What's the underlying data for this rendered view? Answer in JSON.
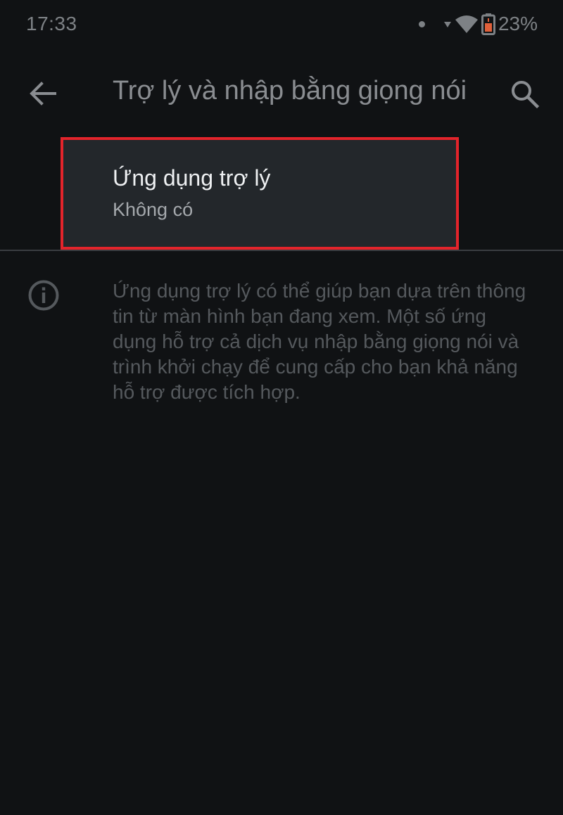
{
  "status_bar": {
    "time": "17:33",
    "battery_percent": "23%",
    "icons": [
      "notification-dot-icon",
      "data-arrow-icon",
      "wifi-icon",
      "battery-icon"
    ]
  },
  "app_bar": {
    "title": "Trợ lý và nhập bằng giọng nói",
    "icons": [
      "back-arrow-icon",
      "search-icon"
    ]
  },
  "settings": {
    "assistant_app": {
      "title": "Ứng dụng trợ lý",
      "value": "Không có"
    }
  },
  "info": {
    "icon": "info-icon",
    "text": "Ứng dụng trợ lý có thể giúp bạn dựa trên thông tin từ màn hình bạn đang xem. Một số ứng dụng hỗ trợ cả dịch vụ nhập bằng giọng nói và trình khởi chạy để cung cấp cho bạn khả năng hỗ trợ được tích hợp."
  },
  "colors": {
    "background": "#101214",
    "highlight_border": "#e3242b",
    "item_background": "#23272b",
    "battery_accent": "#e0603a"
  }
}
